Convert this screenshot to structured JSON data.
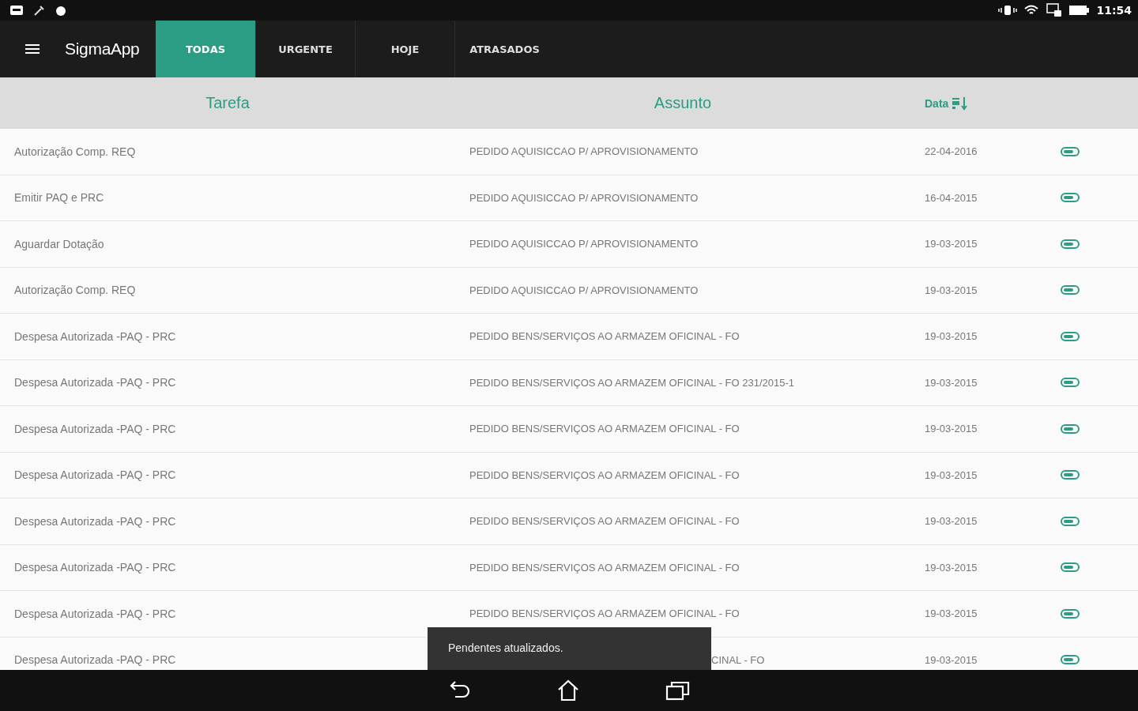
{
  "status_bar": {
    "time": "11:54"
  },
  "app_bar": {
    "title": "SigmaApp"
  },
  "tabs": [
    {
      "label": "TODAS",
      "selected": true
    },
    {
      "label": "URGENTE",
      "selected": false
    },
    {
      "label": "HOJE",
      "selected": false
    },
    {
      "label": "ATRASADOS",
      "selected": false
    }
  ],
  "table": {
    "columns": [
      "Tarefa",
      "Assunto",
      "Data"
    ],
    "rows": [
      {
        "task": "Autorização Comp. REQ",
        "subject": "PEDIDO AQUISICCAO P/ APROVISIONAMENTO",
        "date": "22-04-2016"
      },
      {
        "task": "Emitir PAQ e PRC",
        "subject": "PEDIDO AQUISICCAO P/ APROVISIONAMENTO",
        "date": "16-04-2015"
      },
      {
        "task": "Aguardar Dotação",
        "subject": "PEDIDO AQUISICCAO P/ APROVISIONAMENTO",
        "date": "19-03-2015"
      },
      {
        "task": "Autorização Comp. REQ",
        "subject": "PEDIDO AQUISICCAO P/ APROVISIONAMENTO",
        "date": "19-03-2015"
      },
      {
        "task": "Despesa Autorizada -PAQ - PRC",
        "subject": "PEDIDO BENS/SERVIÇOS AO ARMAZEM OFICINAL - FO",
        "date": "19-03-2015"
      },
      {
        "task": "Despesa Autorizada -PAQ - PRC",
        "subject": "PEDIDO BENS/SERVIÇOS AO ARMAZEM OFICINAL - FO 231/2015-1",
        "date": "19-03-2015"
      },
      {
        "task": "Despesa Autorizada -PAQ - PRC",
        "subject": "PEDIDO BENS/SERVIÇOS AO ARMAZEM OFICINAL - FO",
        "date": "19-03-2015"
      },
      {
        "task": "Despesa Autorizada -PAQ - PRC",
        "subject": "PEDIDO BENS/SERVIÇOS AO ARMAZEM OFICINAL - FO",
        "date": "19-03-2015"
      },
      {
        "task": "Despesa Autorizada -PAQ - PRC",
        "subject": "PEDIDO BENS/SERVIÇOS AO ARMAZEM OFICINAL - FO",
        "date": "19-03-2015"
      },
      {
        "task": "Despesa Autorizada -PAQ - PRC",
        "subject": "PEDIDO BENS/SERVIÇOS AO ARMAZEM OFICINAL - FO",
        "date": "19-03-2015"
      },
      {
        "task": "Despesa Autorizada -PAQ - PRC",
        "subject": "PEDIDO BENS/SERVIÇOS AO ARMAZEM OFICINAL - FO",
        "date": "19-03-2015"
      },
      {
        "task": "Despesa Autorizada -PAQ - PRC",
        "subject": "CINAL - FO",
        "subject_covered": true,
        "date": "19-03-2015"
      }
    ]
  },
  "toast": {
    "message": "Pendentes atualizados."
  }
}
